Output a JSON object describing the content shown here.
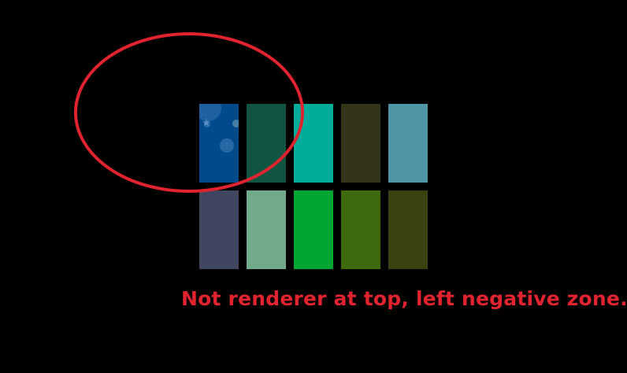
{
  "tiles": [
    {
      "color": "#004a8c",
      "icon": "weather-bokeh-icon"
    },
    {
      "color": "#125442"
    },
    {
      "color": "#00ac9a"
    },
    {
      "color": "#34341a"
    },
    {
      "color": "#5095a5"
    },
    {
      "color": "#404660"
    },
    {
      "color": "#72aa8c"
    },
    {
      "color": "#00a634"
    },
    {
      "color": "#3f690d"
    },
    {
      "color": "#3c4112"
    }
  ],
  "annotation": {
    "caption": "Not renderer at top, left negative zone.",
    "color": "#e0232e"
  }
}
